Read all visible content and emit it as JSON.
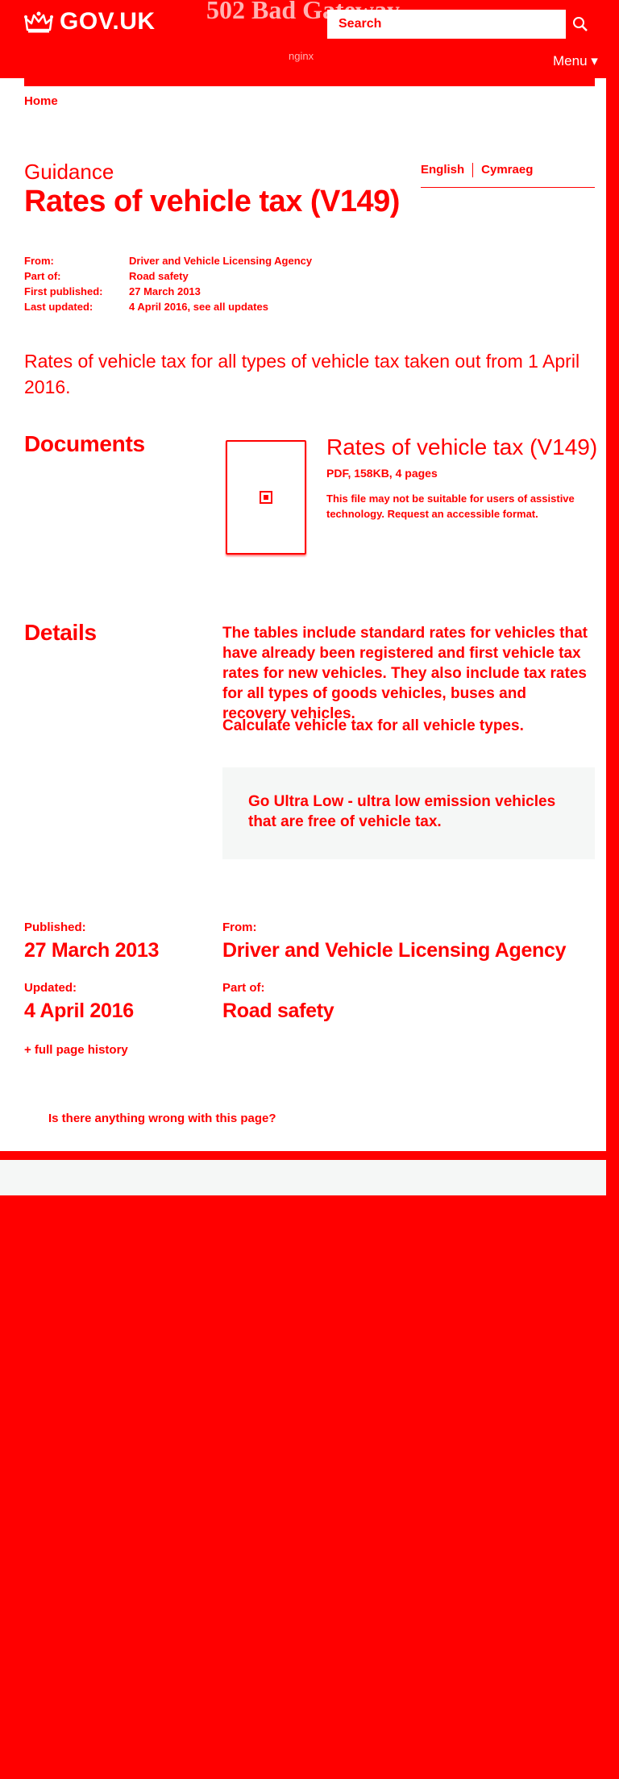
{
  "header": {
    "logo_text": "GOV.UK",
    "error_title": "502 Bad Gateway",
    "error_server": "nginx",
    "search_placeholder": "Search",
    "menu_label": "Menu ▾"
  },
  "breadcrumb": {
    "home": "Home"
  },
  "page": {
    "caption": "Guidance",
    "title": "Rates of vehicle tax (V149)",
    "languages": [
      "English",
      "Cymraeg"
    ],
    "lead": "Rates of vehicle tax for all types of vehicle tax taken out from 1 April 2016."
  },
  "meta": {
    "from_label": "From:",
    "from_value": "Driver and Vehicle Licensing Agency",
    "partof_label": "Part of:",
    "partof_value": "Road safety",
    "first_label": "First published:",
    "first_value": "27 March 2013",
    "updated_label": "Last updated:",
    "updated_value": "4 April 2016, ",
    "updated_link": "see all updates"
  },
  "documents": {
    "heading": "Documents",
    "title": "Rates of vehicle tax (V149)",
    "meta": "PDF, 158KB, 4 pages",
    "note": "This file may not be suitable for users of assistive technology. ",
    "note_link": "Request an accessible format."
  },
  "details": {
    "heading": "Details",
    "paragraph": "The tables include standard rates for vehicles that have already been registered and first vehicle tax rates for new vehicles. They also include tax rates for all types of goods vehicles, buses and recovery vehicles.",
    "calc_link": "Calculate vehicle tax",
    "calc_rest": " for all vehicle types.",
    "inset_link": "Go Ultra Low",
    "inset_rest": " - ultra low emission vehicles that are free of vehicle tax."
  },
  "footer_meta": {
    "published_label": "Published:",
    "published_value": "27 March 2013",
    "updated_label": "Updated:",
    "updated_value": "4 April 2016",
    "from_label": "From:",
    "from_value": "Driver and Vehicle Licensing Agency",
    "partof_label": "Part of:",
    "partof_value": "Road safety",
    "history_link": "+ full page history"
  },
  "feedback": {
    "link": "Is there anything wrong with this page?"
  },
  "colors": {
    "accent": "#ff0000",
    "page": "#ffffff",
    "inset": "#f5f7f6"
  }
}
